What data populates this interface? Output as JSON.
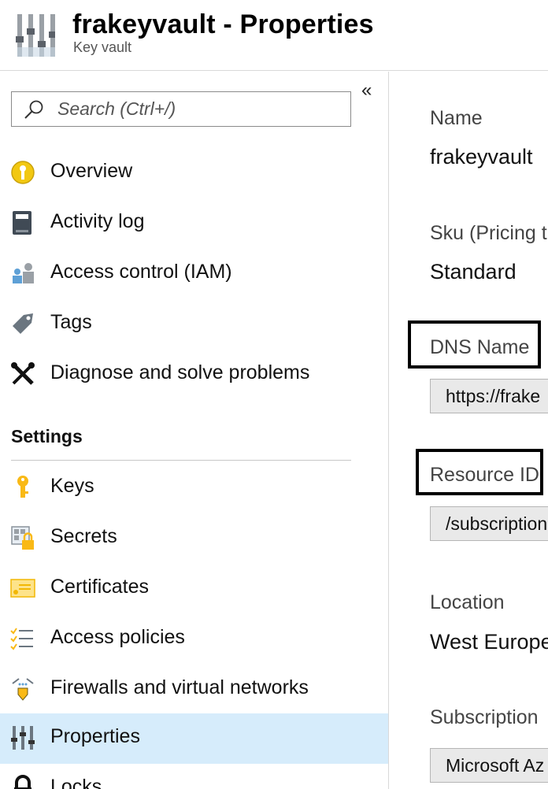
{
  "header": {
    "title": "frakeyvault - Properties",
    "subtitle": "Key vault",
    "icon": "properties-sliders-icon"
  },
  "sidebar": {
    "collapse_label": "«",
    "search": {
      "placeholder": "Search (Ctrl+/)",
      "value": ""
    },
    "items": [
      {
        "label": "Overview",
        "icon": "overview-icon"
      },
      {
        "label": "Activity log",
        "icon": "activity-log-icon"
      },
      {
        "label": "Access control (IAM)",
        "icon": "access-control-icon"
      },
      {
        "label": "Tags",
        "icon": "tag-icon"
      },
      {
        "label": "Diagnose and solve problems",
        "icon": "tools-icon"
      }
    ],
    "settings_header": "Settings",
    "settings_items": [
      {
        "label": "Keys",
        "icon": "key-icon"
      },
      {
        "label": "Secrets",
        "icon": "secret-icon"
      },
      {
        "label": "Certificates",
        "icon": "certificate-icon"
      },
      {
        "label": "Access policies",
        "icon": "access-policies-icon"
      },
      {
        "label": "Firewalls and virtual networks",
        "icon": "firewall-icon"
      },
      {
        "label": "Properties",
        "icon": "properties-icon",
        "active": true
      },
      {
        "label": "Locks",
        "icon": "lock-icon"
      }
    ]
  },
  "main": {
    "name": {
      "label": "Name",
      "value": "frakeyvault"
    },
    "sku": {
      "label": "Sku (Pricing t",
      "value": "Standard"
    },
    "dns": {
      "label": "DNS Name",
      "value": "https://frake"
    },
    "resource_id": {
      "label": "Resource ID",
      "value": "/subscription"
    },
    "location": {
      "label": "Location",
      "value": "West Europe"
    },
    "subscription": {
      "label": "Subscription",
      "value": "Microsoft Az"
    }
  },
  "colors": {
    "active_background": "#d6ecfb",
    "overview_yellow": "#f2c811",
    "key_yellow": "#f9b916"
  }
}
